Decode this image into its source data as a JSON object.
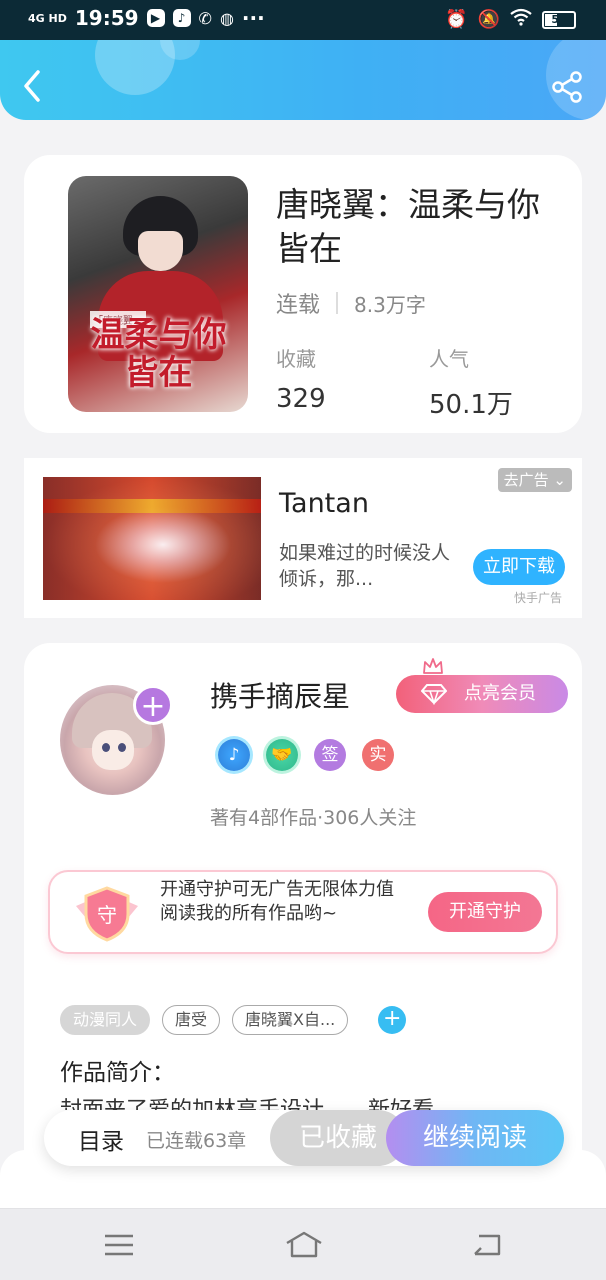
{
  "status_bar": {
    "network": "4G HD",
    "time": "19:59",
    "more_icons": "···",
    "battery": "51"
  },
  "book": {
    "title": "唐晓翼：温柔与你皆在",
    "cover_title": "温柔与你皆在",
    "cover_subtitle": "「唐晓翼」",
    "status": "连载",
    "word_count": "8.3万字",
    "favorites_label": "收藏",
    "favorites_value": "329",
    "popularity_label": "人气",
    "popularity_value": "50.1万"
  },
  "ad": {
    "name": "Tantan",
    "description": "如果难过的时候没人倾诉，那...",
    "close_label": "去广告",
    "download_label": "立即下载",
    "source": "快手广告"
  },
  "author": {
    "name": "携手摘辰星",
    "vip_label": "点亮会员",
    "badges": [
      "♪",
      "签",
      "实"
    ],
    "stats": "著有4部作品·306人关注",
    "guard_text": "开通守护可无广告无限体力值阅读我的所有作品哟~",
    "guard_shield_char": "守",
    "guard_button": "开通守护",
    "tags": [
      "动漫同人",
      "唐受",
      "唐晓翼X自..."
    ],
    "intro_title": "作品简介：",
    "intro_peek": "封面来了爱的加林高手设计……新好看……"
  },
  "bottom_bar": {
    "toc_label": "目录",
    "toc_count": "已连载63章",
    "favorited_label": "已收藏",
    "continue_label": "继续阅读"
  },
  "colors": {
    "header_gradient_start": "#3fc8f0",
    "header_gradient_end": "#4aa7f7",
    "vip_pink": "#f2617a",
    "guard_pink": "#f56686",
    "accent_blue": "#2fb3ff"
  },
  "icons": [
    "back-arrow-icon",
    "share-icon",
    "crown-icon",
    "diamond-icon",
    "shield-icon",
    "menu-icon",
    "home-icon",
    "back-nav-icon"
  ]
}
